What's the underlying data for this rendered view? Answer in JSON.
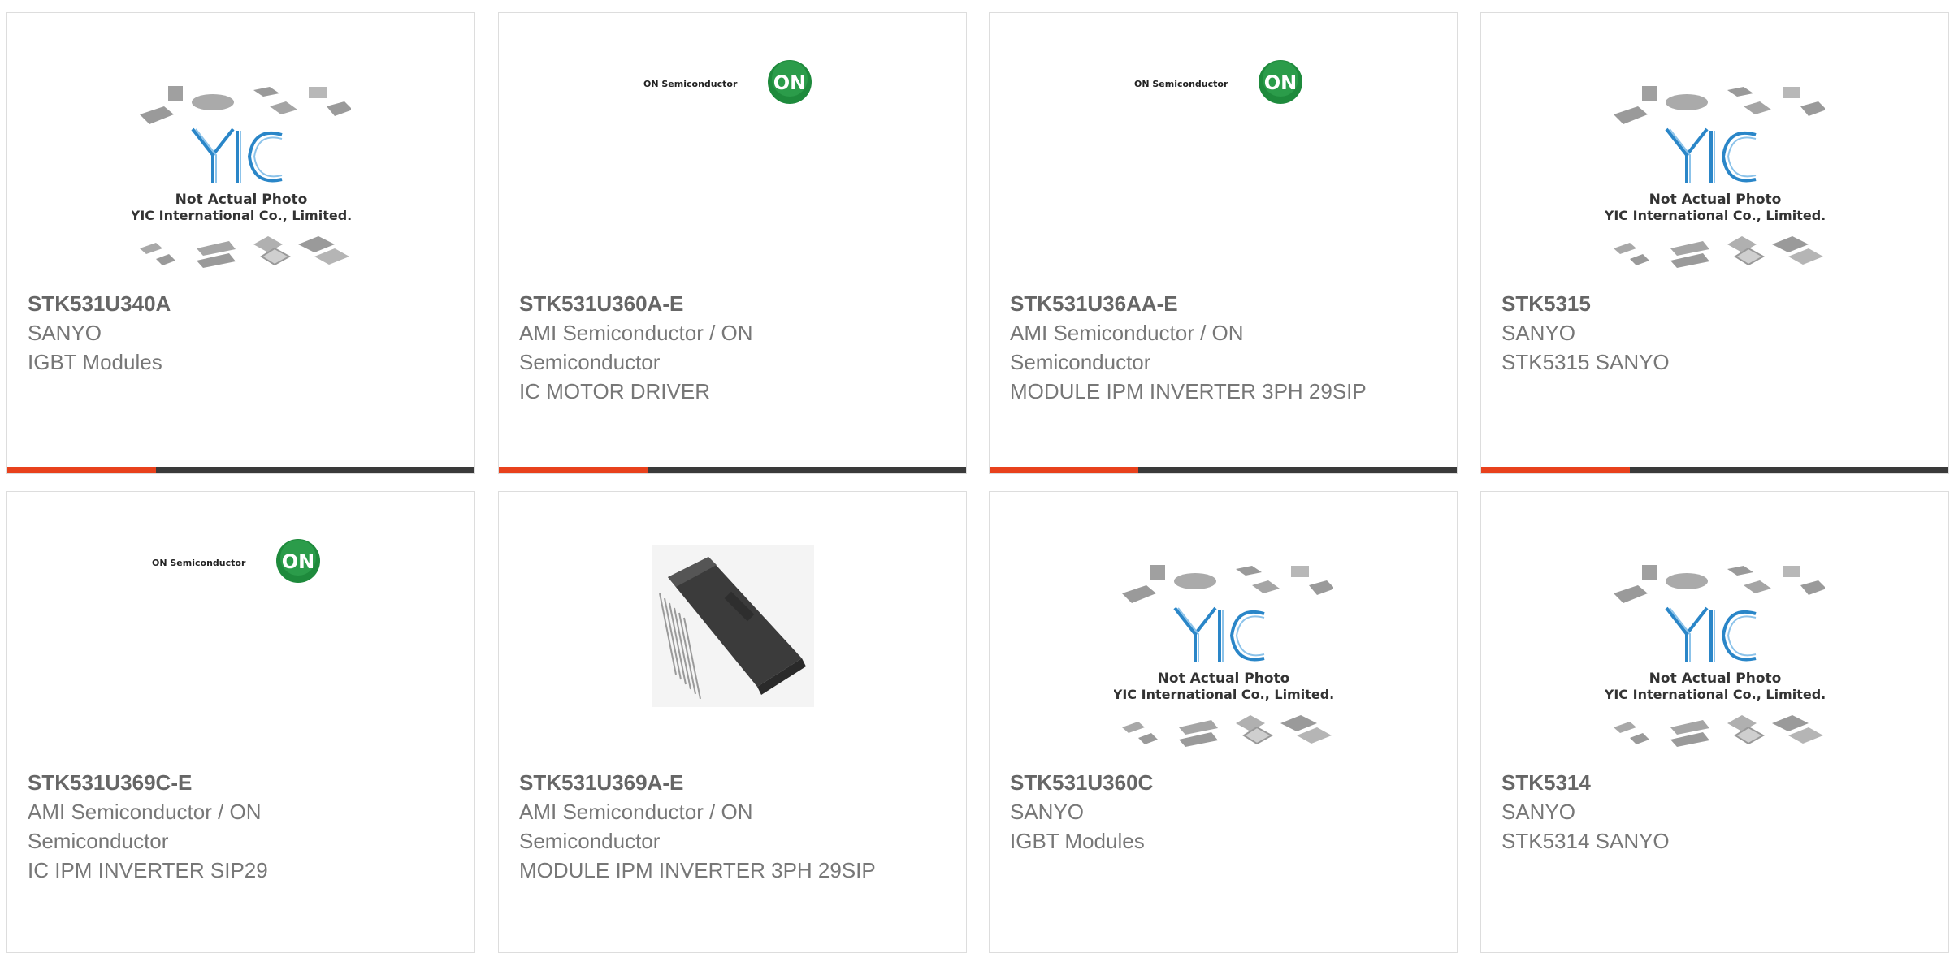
{
  "products": [
    {
      "part": "STK531U340A",
      "manufacturer": "SANYO",
      "description": "IGBT Modules",
      "image": "yic-placeholder",
      "image_text_1": "Not Actual Photo",
      "image_text_2": "YIC International Co., Limited."
    },
    {
      "part": "STK531U360A-E",
      "manufacturer": "AMI Semiconductor / ON Semiconductor",
      "description": "IC MOTOR DRIVER",
      "image": "on-semiconductor-logo",
      "logo_text": "ON Semiconductor",
      "logo_badge": "ON"
    },
    {
      "part": "STK531U36AA-E",
      "manufacturer": "AMI Semiconductor / ON Semiconductor",
      "description": "MODULE IPM INVERTER 3PH 29SIP",
      "image": "on-semiconductor-logo",
      "logo_text": "ON Semiconductor",
      "logo_badge": "ON"
    },
    {
      "part": "STK5315",
      "manufacturer": "SANYO",
      "description": "STK5315 SANYO",
      "image": "yic-placeholder",
      "image_text_1": "Not Actual Photo",
      "image_text_2": "YIC International Co., Limited."
    },
    {
      "part": "STK531U369C-E",
      "manufacturer": "AMI Semiconductor / ON Semiconductor",
      "description": "IC IPM INVERTER SIP29",
      "image": "on-semiconductor-logo",
      "logo_text": "ON Semiconductor",
      "logo_badge": "ON"
    },
    {
      "part": "STK531U369A-E",
      "manufacturer": "AMI Semiconductor / ON Semiconductor",
      "description": "MODULE IPM INVERTER 3PH 29SIP",
      "image": "module-photo"
    },
    {
      "part": "STK531U360C",
      "manufacturer": "SANYO",
      "description": "IGBT Modules",
      "image": "yic-placeholder",
      "image_text_1": "Not Actual Photo",
      "image_text_2": "YIC International Co., Limited."
    },
    {
      "part": "STK5314",
      "manufacturer": "SANYO",
      "description": "STK5314 SANYO",
      "image": "yic-placeholder",
      "image_text_1": "Not Actual Photo",
      "image_text_2": "YIC International Co., Limited."
    }
  ],
  "colors": {
    "accent": "#e8411c",
    "bar": "#3a3a3a",
    "on_green": "#1e8a3c",
    "yic_blue": "#1f7fc4"
  }
}
